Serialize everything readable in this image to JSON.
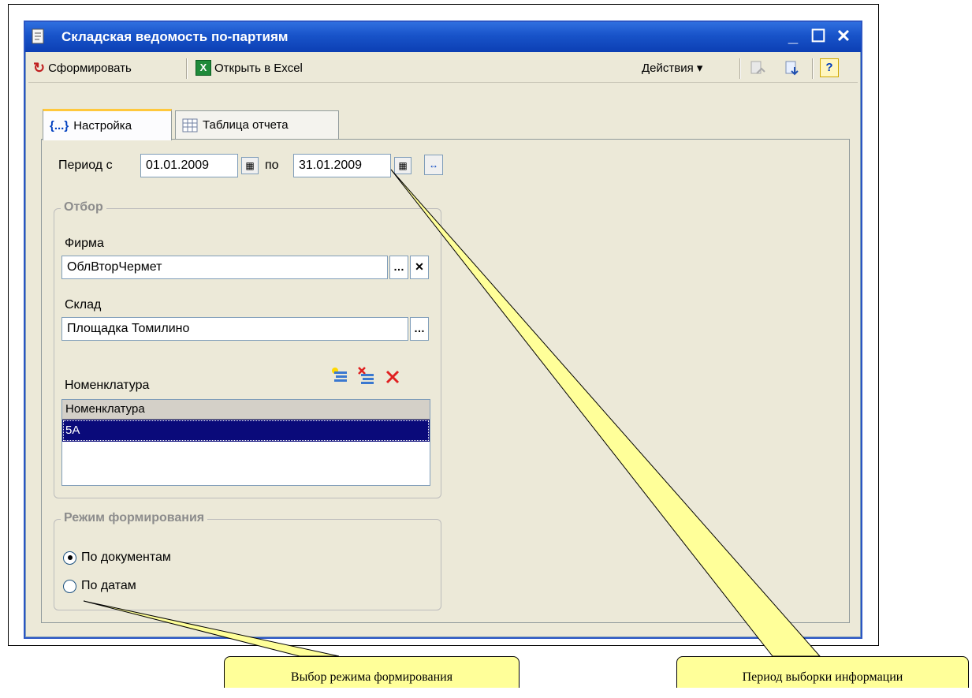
{
  "window": {
    "title": "Складская ведомость по-партиям"
  },
  "toolbar": {
    "generate_label": "Сформировать",
    "excel_label": "Открыть в Excel",
    "actions_label": "Действия ▾",
    "help_label": "?"
  },
  "tabs": [
    {
      "label": "Настройка",
      "icon": "{...}"
    },
    {
      "label": "Таблица отчета"
    }
  ],
  "period": {
    "label_from": "Период с",
    "from": "01.01.2009",
    "label_to": "по",
    "to": "31.01.2009"
  },
  "filter": {
    "title": "Отбор",
    "firm_label": "Фирма",
    "firm_value": "ОблВторЧермет",
    "warehouse_label": "Склад",
    "warehouse_value": "Площадка Томилино",
    "nomenclature_label": "Номенклатура",
    "grid_header": "Номенклатура",
    "grid_rows": [
      "5А"
    ]
  },
  "mode": {
    "title": "Режим формирования",
    "options": [
      "По документам",
      "По датам"
    ],
    "selected": 0
  },
  "callouts": {
    "mode": "Выбор режима формирования",
    "period": "Период выборки информации"
  },
  "colors": {
    "titlebar": "#1853c9",
    "callout_fill": "#ffff99",
    "selection": "#0a0a7a"
  }
}
